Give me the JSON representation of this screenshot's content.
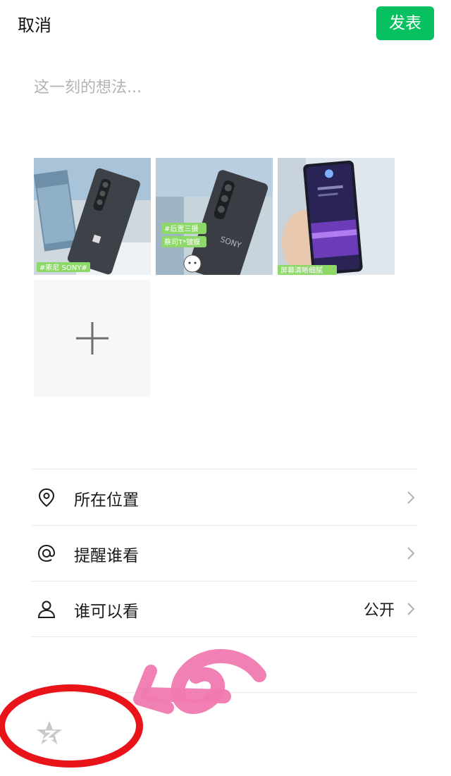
{
  "header": {
    "cancel_label": "取消",
    "publish_label": "发表",
    "accent_color": "#07c160"
  },
  "composer": {
    "placeholder": "这一刻的想法..."
  },
  "photos": {
    "items": [
      {
        "caption": "#索尼 SONY#"
      },
      {
        "caption_line1": "#后置三摄",
        "caption_line2": "蔡司T*镀膜",
        "brand_text": "SONY"
      },
      {
        "caption": "屏幕清晰细腻"
      }
    ],
    "add_icon": "plus-icon"
  },
  "options": [
    {
      "icon": "location-pin-icon",
      "label": "所在位置",
      "value": ""
    },
    {
      "icon": "at-sign-icon",
      "label": "提醒谁看",
      "value": ""
    },
    {
      "icon": "person-icon",
      "label": "谁可以看",
      "value": "公开"
    }
  ],
  "footer": {
    "icon": "star-badge-icon"
  }
}
